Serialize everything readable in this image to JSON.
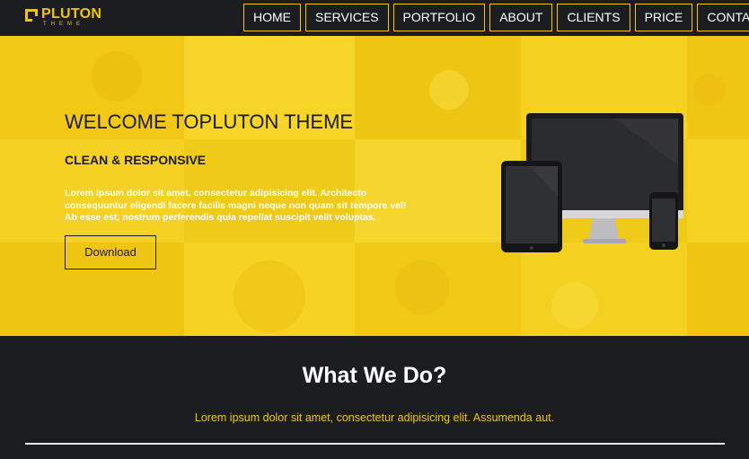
{
  "brand": {
    "name": "PLUTON",
    "tagline": "THEME",
    "accent": "#f2c40f"
  },
  "nav": {
    "items": [
      "HOME",
      "SERVICES",
      "PORTFOLIO",
      "ABOUT",
      "CLIENTS",
      "PRICE",
      "CONTACT"
    ]
  },
  "hero": {
    "title": "WELCOME TOPLUTON THEME",
    "subtitle": "CLEAN & RESPONSIVE",
    "text": "Lorem ipsum dolor sit amet, consectetur adipisicing elit. Architecto consequuntur eligendi facere facilis magni neque non quam sit tempore vel! Ab esse est, nostrum perferendis quia repellat suscipit velit voluptas.",
    "button_label": "Download",
    "background": "#f3cf1c"
  },
  "section": {
    "title": "What We Do?",
    "text": "Lorem ipsum dolor sit amet, consectetur adipisicing elit. Assumenda aut."
  },
  "colors": {
    "dark": "#1c1d21",
    "text_light": "#ffffff"
  }
}
